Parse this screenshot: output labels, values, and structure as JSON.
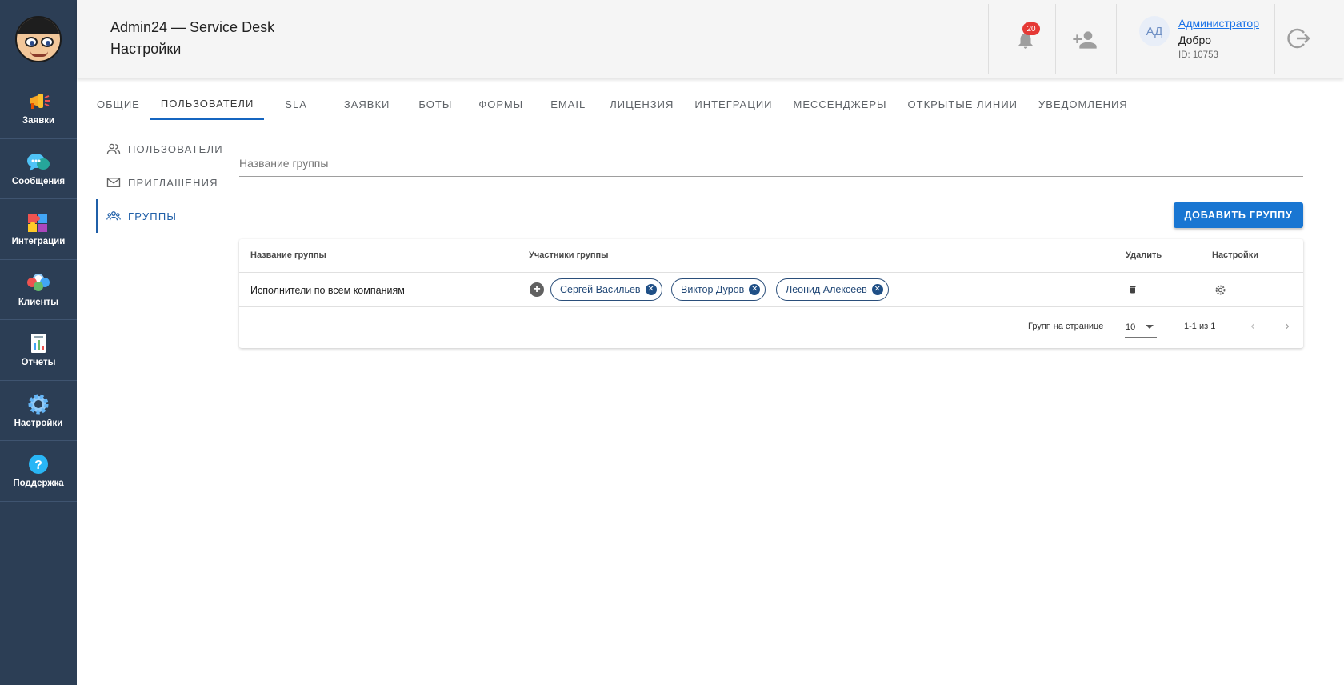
{
  "sidebar": {
    "items": [
      {
        "label": "Заявки",
        "icon": "megaphone-icon"
      },
      {
        "label": "Сообщения",
        "icon": "chat-bubble-icon"
      },
      {
        "label": "Интеграции",
        "icon": "puzzle-icon"
      },
      {
        "label": "Клиенты",
        "icon": "people-icon"
      },
      {
        "label": "Отчеты",
        "icon": "report-icon"
      },
      {
        "label": "Настройки",
        "icon": "gear-icon"
      },
      {
        "label": "Поддержка",
        "icon": "question-icon"
      }
    ]
  },
  "header": {
    "app_title": "Admin24 — Service Desk",
    "page_title": "Настройки",
    "notifications_count": "20",
    "user": {
      "initials": "АД",
      "name": "Администратор",
      "greeting": "Добро",
      "id": "ID: 10753"
    }
  },
  "tabs": [
    "Общие",
    "Пользователи",
    "SLA",
    "Заявки",
    "Боты",
    "Формы",
    "Email",
    "Лицензия",
    "Интеграции",
    "Мессенджеры",
    "Открытые линии",
    "Уведомления"
  ],
  "active_tab": "Пользователи",
  "subnav": {
    "items": [
      {
        "label": "Пользователи",
        "icon": "users-icon"
      },
      {
        "label": "Приглашения",
        "icon": "envelope-icon"
      },
      {
        "label": "Группы",
        "icon": "group-icon"
      }
    ],
    "active": "Группы"
  },
  "group_form": {
    "placeholder": "Название группы",
    "value": "",
    "add_button": "Добавить группу"
  },
  "table": {
    "columns": {
      "name": "Название группы",
      "members": "Участники группы",
      "delete": "Удалить",
      "settings": "Настройки"
    },
    "rows": [
      {
        "name": "Исполнители по всем компаниям",
        "members": [
          "Сергей Васильев",
          "Виктор Дуров",
          "Леонид Алексеев"
        ]
      }
    ],
    "pagination": {
      "rows_label": "Групп на странице",
      "rows_per_page": "10",
      "range": "1-1 из 1"
    }
  },
  "colors": {
    "sidebar_bg": "#2c3e55",
    "accent": "#1976d2",
    "badge": "#e53935"
  }
}
